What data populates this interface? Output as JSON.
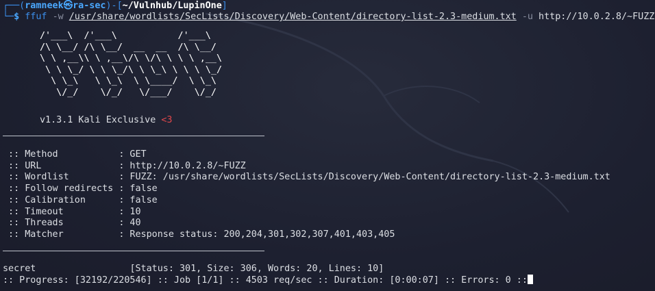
{
  "prompt": {
    "user": "ramneek",
    "at": "㉿",
    "host": "ra-sec",
    "cwd": "~/Vulnhub/LupinOne",
    "command": "ffuf",
    "flag_w": "-w",
    "wordlist_path": "/usr/share/wordlists/SecLists/Discovery/Web-Content/directory-list-2.3-medium.txt",
    "flag_u": "-u",
    "url": "http://10.0.2.8/~FUZZ"
  },
  "banner": {
    "ascii": "/'___\\  /'___\\           /'___\\\n/\\ \\__/ /\\ \\__/  __  __  /\\ \\__/\n\\ \\ ,__\\\\ \\ ,__\\/\\ \\/\\ \\ \\ \\ ,__\\\n \\ \\ \\_/ \\ \\ \\_/\\ \\ \\_\\ \\ \\ \\ \\_/\n  \\ \\_\\   \\ \\_\\  \\ \\____/  \\ \\_\\\n   \\/_/    \\/_/   \\/___/    \\/_/",
    "version": "v1.3.1 Kali Exclusive",
    "heart": "<3"
  },
  "config": [
    {
      "key": " :: Method           ",
      "value": ": GET"
    },
    {
      "key": " :: URL              ",
      "value": ": http://10.0.2.8/~FUZZ"
    },
    {
      "key": " :: Wordlist         ",
      "value": ": FUZZ: /usr/share/wordlists/SecLists/Discovery/Web-Content/directory-list-2.3-medium.txt"
    },
    {
      "key": " :: Follow redirects ",
      "value": ": false"
    },
    {
      "key": " :: Calibration      ",
      "value": ": false"
    },
    {
      "key": " :: Timeout          ",
      "value": ": 10"
    },
    {
      "key": " :: Threads          ",
      "value": ": 40"
    },
    {
      "key": " :: Matcher          ",
      "value": ": Response status: 200,204,301,302,307,401,403,405"
    }
  ],
  "result": {
    "word": "secret",
    "details": "[Status: 301, Size: 306, Words: 20, Lines: 10]"
  },
  "progress": ":: Progress: [32192/220546] :: Job [1/1] :: 4503 req/sec :: Duration: [0:00:07] :: Errors: 0 ::"
}
